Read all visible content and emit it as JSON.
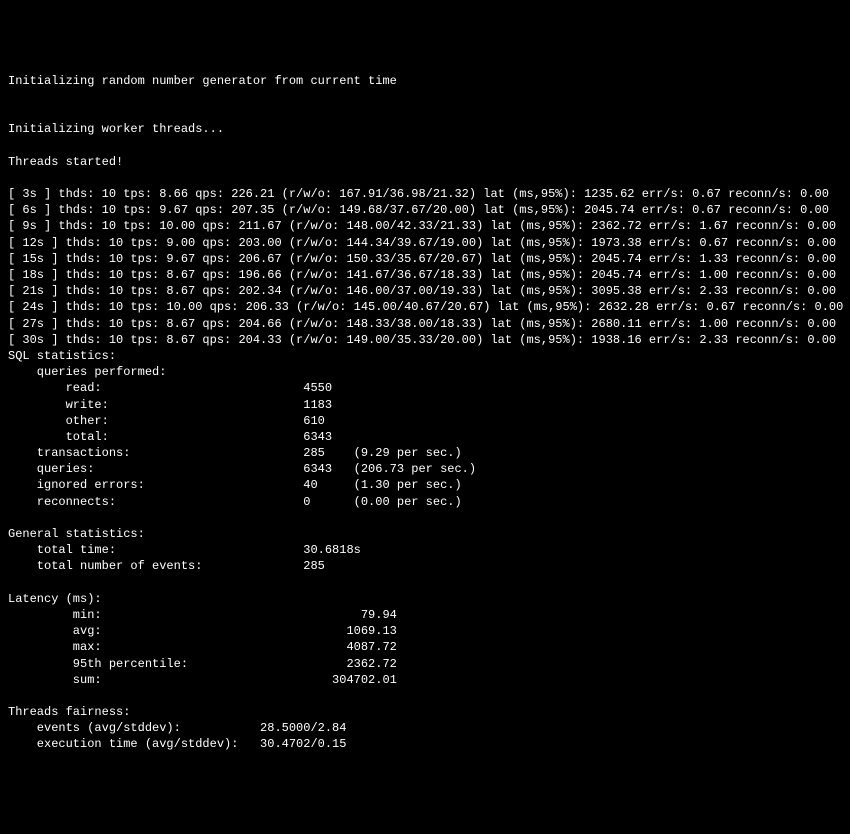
{
  "header": {
    "line1": "Initializing random number generator from current time",
    "line2": "Initializing worker threads...",
    "line3": "Threads started!"
  },
  "progress": [
    "[ 3s ] thds: 10 tps: 8.66 qps: 226.21 (r/w/o: 167.91/36.98/21.32) lat (ms,95%): 1235.62 err/s: 0.67 reconn/s: 0.00",
    "[ 6s ] thds: 10 tps: 9.67 qps: 207.35 (r/w/o: 149.68/37.67/20.00) lat (ms,95%): 2045.74 err/s: 0.67 reconn/s: 0.00",
    "[ 9s ] thds: 10 tps: 10.00 qps: 211.67 (r/w/o: 148.00/42.33/21.33) lat (ms,95%): 2362.72 err/s: 1.67 reconn/s: 0.00",
    "[ 12s ] thds: 10 tps: 9.00 qps: 203.00 (r/w/o: 144.34/39.67/19.00) lat (ms,95%): 1973.38 err/s: 0.67 reconn/s: 0.00",
    "[ 15s ] thds: 10 tps: 9.67 qps: 206.67 (r/w/o: 150.33/35.67/20.67) lat (ms,95%): 2045.74 err/s: 1.33 reconn/s: 0.00",
    "[ 18s ] thds: 10 tps: 8.67 qps: 196.66 (r/w/o: 141.67/36.67/18.33) lat (ms,95%): 2045.74 err/s: 1.00 reconn/s: 0.00",
    "[ 21s ] thds: 10 tps: 8.67 qps: 202.34 (r/w/o: 146.00/37.00/19.33) lat (ms,95%): 3095.38 err/s: 2.33 reconn/s: 0.00",
    "[ 24s ] thds: 10 tps: 10.00 qps: 206.33 (r/w/o: 145.00/40.67/20.67) lat (ms,95%): 2632.28 err/s: 0.67 reconn/s: 0.00",
    "[ 27s ] thds: 10 tps: 8.67 qps: 204.66 (r/w/o: 148.33/38.00/18.33) lat (ms,95%): 2680.11 err/s: 1.00 reconn/s: 0.00",
    "[ 30s ] thds: 10 tps: 8.67 qps: 204.33 (r/w/o: 149.00/35.33/20.00) lat (ms,95%): 1938.16 err/s: 2.33 reconn/s: 0.00"
  ],
  "sql_stats": {
    "title": "SQL statistics:",
    "queries_performed_label": "    queries performed:",
    "read": "        read:                            4550",
    "write": "        write:                           1183",
    "other": "        other:                           610",
    "total": "        total:                           6343",
    "transactions": "    transactions:                        285    (9.29 per sec.)",
    "queries": "    queries:                             6343   (206.73 per sec.)",
    "ignored": "    ignored errors:                      40     (1.30 per sec.)",
    "reconnects": "    reconnects:                          0      (0.00 per sec.)"
  },
  "general_stats": {
    "title": "General statistics:",
    "total_time": "    total time:                          30.6818s",
    "total_events": "    total number of events:              285"
  },
  "latency": {
    "title": "Latency (ms):",
    "min": "         min:                                    79.94",
    "avg": "         avg:                                  1069.13",
    "max": "         max:                                  4087.72",
    "p95": "         95th percentile:                      2362.72",
    "sum": "         sum:                                304702.01"
  },
  "fairness": {
    "title": "Threads fairness:",
    "events": "    events (avg/stddev):           28.5000/2.84",
    "exec": "    execution time (avg/stddev):   30.4702/0.15"
  }
}
